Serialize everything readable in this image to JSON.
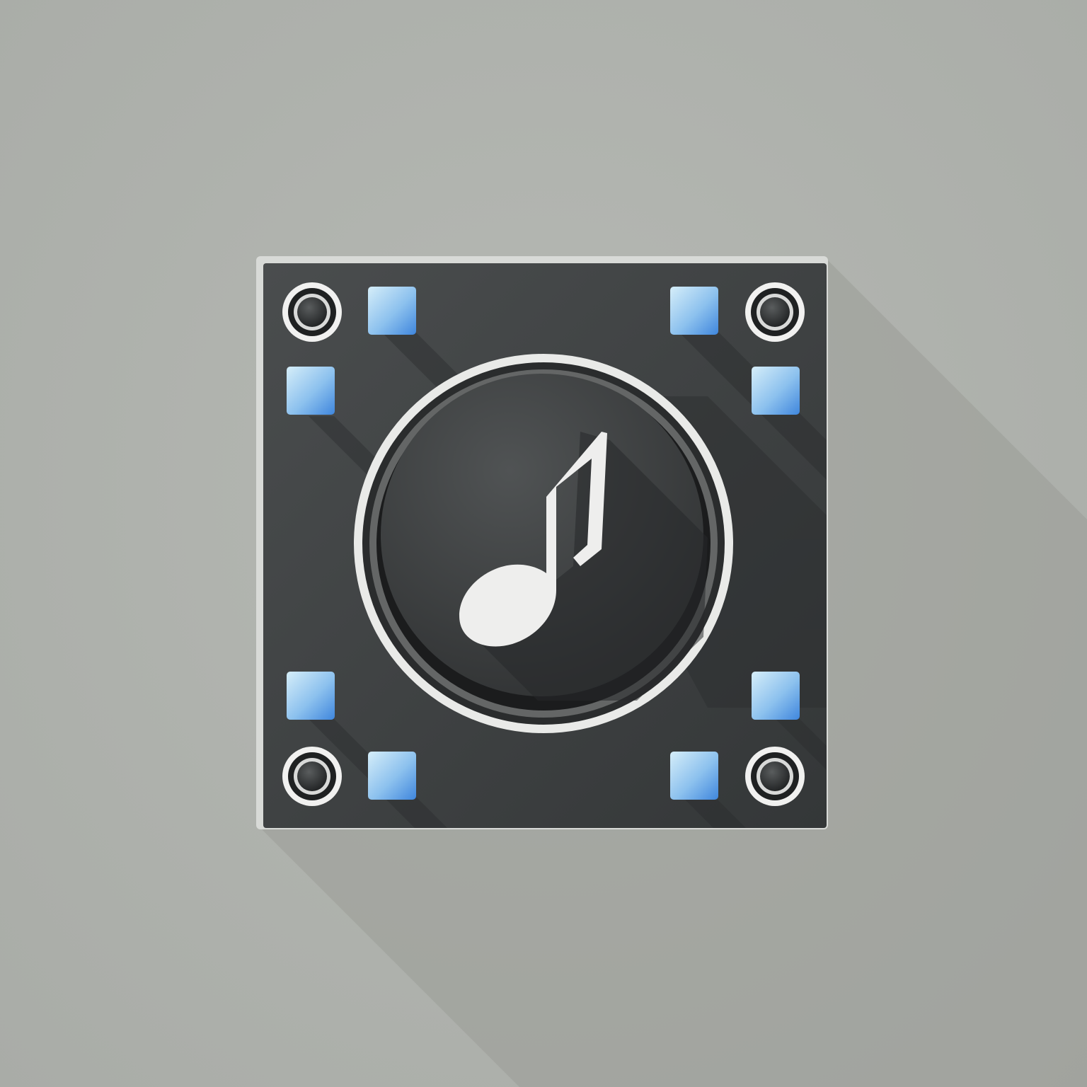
{
  "icon": {
    "name": "music-player-app-icon",
    "glyph": "music-note-icon",
    "colors": {
      "background": "#b0b3ae",
      "panel": "#3e4142",
      "panel_edge": "#d9dbd8",
      "knob": "#3b3d3e",
      "ring": "#e6e7e5",
      "note": "#eeeeed",
      "pad_light": "#d4ecf8",
      "pad_dark": "#4a8fe0",
      "screw_ring": "#f2f2f2",
      "screw_core": "#2a2c2d"
    },
    "pads": 8,
    "screws": 4
  }
}
